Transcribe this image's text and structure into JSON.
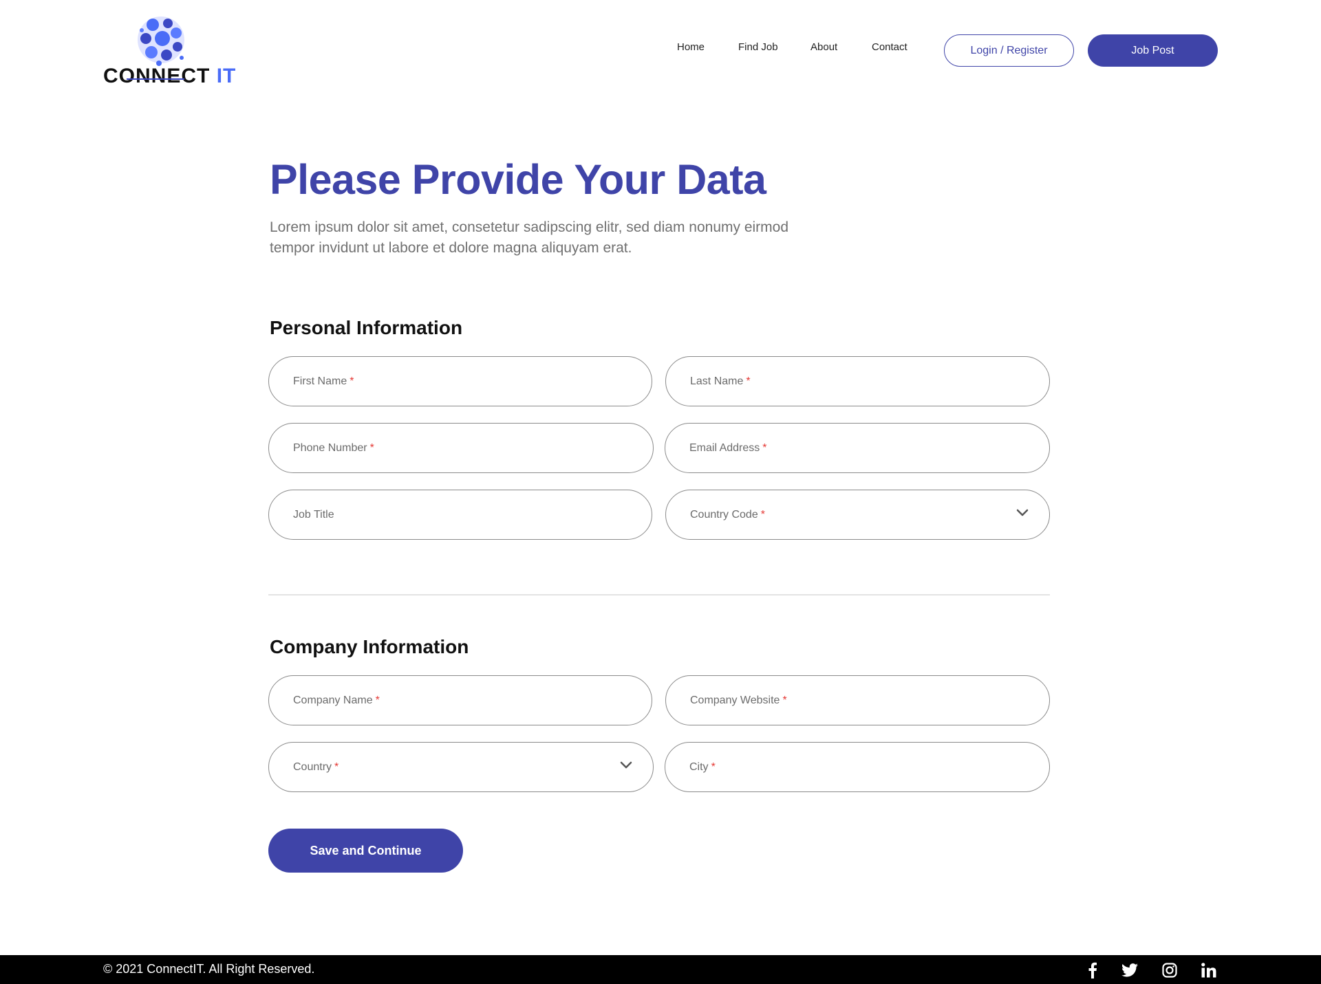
{
  "header": {
    "logo_text_main": "CONNECT",
    "logo_text_accent": "IT",
    "nav": [
      "Home",
      "Find Job",
      "About",
      "Contact"
    ],
    "login_label": "Login / Register",
    "post_label": "Job Post"
  },
  "hero": {
    "title": "Please Provide Your Data",
    "subtitle": "Lorem ipsum dolor sit amet, consetetur sadipscing elitr, sed diam nonumy eirmod tempor invidunt ut labore et dolore magna aliquyam erat."
  },
  "personal": {
    "heading": "Personal Information",
    "first_name": "First Name",
    "last_name": "Last Name",
    "phone": "Phone Number",
    "email": "Email Address",
    "job_title": "Job Title",
    "country_code": "Country Code"
  },
  "company": {
    "heading": "Company Information",
    "name": "Company Name",
    "website": "Company Website",
    "country": "Country",
    "city": "City"
  },
  "required_mark": "*",
  "save_label": "Save and Continue",
  "footer": {
    "copyright": "© 2021 ConnectIT. All Right Reserved.",
    "social_icons": [
      "facebook-icon",
      "twitter-icon",
      "instagram-icon",
      "linkedin-icon"
    ]
  },
  "colors": {
    "brand": "#3f44a8",
    "required": "#e53935",
    "footer_bg": "#000000"
  }
}
